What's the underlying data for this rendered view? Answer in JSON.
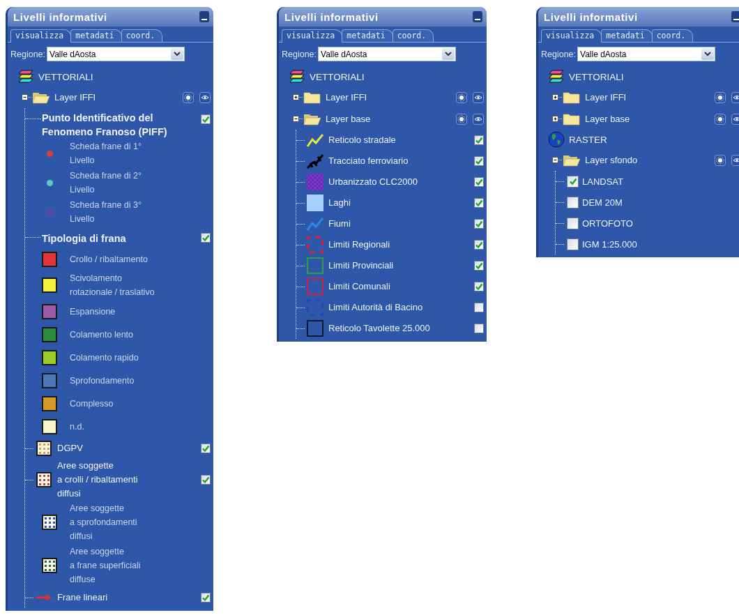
{
  "panels": [
    {
      "title": "Livelli informativi",
      "tabs": [
        {
          "label": "visualizza",
          "selected": true
        },
        {
          "label": "metadati",
          "selected": false
        },
        {
          "label": "coord.",
          "selected": false
        }
      ],
      "region": {
        "label": "Regione:",
        "value": "Valle dAosta"
      },
      "tree": [
        {
          "kind": "category",
          "symbol": {
            "kind": "layers"
          },
          "label": "VETTORIALI",
          "children": [
            {
              "kind": "folder",
              "label": "Layer IFFI",
              "expanded": true,
              "children": [
                {
                  "kind": "section",
                  "label": "Punto Identificativo del\nFenomeno Franoso (PIFF)",
                  "checked": true,
                  "legend": [
                    {
                      "symbol": {
                        "kind": "dot",
                        "color": "#e03c3c"
                      },
                      "label": "Scheda frane di 1°\nLivello"
                    },
                    {
                      "symbol": {
                        "kind": "dot",
                        "color": "#5ec8c8"
                      },
                      "label": "Scheda frane di 2°\nLivello"
                    },
                    {
                      "symbol": {
                        "kind": "dot",
                        "color": "#6a3f9a"
                      },
                      "label": "Scheda frane di 3°\nLivello"
                    }
                  ]
                },
                {
                  "kind": "section",
                  "label": "Tipologia di frana",
                  "checked": true,
                  "legend": [
                    {
                      "symbol": {
                        "kind": "square",
                        "color": "#e0363a"
                      },
                      "label": "Crollo / ribaltamento"
                    },
                    {
                      "symbol": {
                        "kind": "square",
                        "color": "#f4f03c"
                      },
                      "label": "Scivolamento\nrotazionale / traslativo"
                    },
                    {
                      "symbol": {
                        "kind": "square",
                        "color": "#9a5aa6"
                      },
                      "label": "Espansione"
                    },
                    {
                      "symbol": {
                        "kind": "square",
                        "color": "#2a8a3c"
                      },
                      "label": "Colamento lento"
                    },
                    {
                      "symbol": {
                        "kind": "square",
                        "color": "#9ccc2c"
                      },
                      "label": "Colamento rapido"
                    },
                    {
                      "symbol": {
                        "kind": "square",
                        "color": "#4a78b8"
                      },
                      "label": "Sprofondamento"
                    },
                    {
                      "symbol": {
                        "kind": "square",
                        "color": "#d49a2a"
                      },
                      "label": "Complesso"
                    },
                    {
                      "symbol": {
                        "kind": "square",
                        "color": "#fbf6c8"
                      },
                      "label": "n.d."
                    }
                  ]
                },
                {
                  "kind": "layer",
                  "label": "DGPV",
                  "checked": true,
                  "symbol": {
                    "kind": "dots",
                    "color": "#d4a040"
                  }
                },
                {
                  "kind": "layer",
                  "label": "Aree soggette\na crolli / ribaltamenti\ndiffusi",
                  "checked": true,
                  "symbol": {
                    "kind": "dots",
                    "color": "#d04040"
                  },
                  "legend": [
                    {
                      "symbol": {
                        "kind": "dots",
                        "color": "#3050a0"
                      },
                      "label": "Aree soggette\na sprofondamenti\ndiffusi"
                    },
                    {
                      "symbol": {
                        "kind": "dots",
                        "color": "#2a6a3a"
                      },
                      "label": "Aree soggette\na frane superficiali\ndiffuse"
                    }
                  ]
                },
                {
                  "kind": "layer",
                  "label": "Frane lineari",
                  "checked": true,
                  "symbol": {
                    "kind": "arrow",
                    "color": "#e03030"
                  }
                }
              ]
            }
          ]
        }
      ]
    },
    {
      "title": "Livelli informativi",
      "tabs": [
        {
          "label": "visualizza",
          "selected": true
        },
        {
          "label": "metadati",
          "selected": false
        },
        {
          "label": "coord.",
          "selected": false
        }
      ],
      "region": {
        "label": "Regione:",
        "value": "Valle dAosta"
      },
      "tree": [
        {
          "kind": "category",
          "symbol": {
            "kind": "layers"
          },
          "label": "VETTORIALI",
          "children": [
            {
              "kind": "folder",
              "label": "Layer IFFI",
              "expanded": false
            },
            {
              "kind": "folder",
              "label": "Layer base",
              "expanded": true,
              "children": [
                {
                  "kind": "layer",
                  "label": "Reticolo stradale",
                  "checked": true,
                  "symbol": {
                    "kind": "zigzag",
                    "color": "#e8e83a"
                  }
                },
                {
                  "kind": "layer",
                  "label": "Tracciato ferroviario",
                  "checked": true,
                  "symbol": {
                    "kind": "rail"
                  }
                },
                {
                  "kind": "layer",
                  "label": "Urbanizzato CLC2000",
                  "checked": true,
                  "symbol": {
                    "kind": "hatch",
                    "color": "#7a3ad0"
                  }
                },
                {
                  "kind": "layer",
                  "label": "Laghi",
                  "checked": true,
                  "symbol": {
                    "kind": "fill",
                    "color": "#a8d0ff"
                  }
                },
                {
                  "kind": "layer",
                  "label": "Fiumi",
                  "checked": true,
                  "symbol": {
                    "kind": "zigzag",
                    "color": "#2a8ae8"
                  }
                },
                {
                  "kind": "layer",
                  "label": "Limiti Regionali",
                  "checked": true,
                  "symbol": {
                    "kind": "dashed-outline",
                    "color": "#e02030"
                  }
                },
                {
                  "kind": "layer",
                  "label": "Limiti Provinciali",
                  "checked": true,
                  "symbol": {
                    "kind": "outline",
                    "color": "#2aa040"
                  }
                },
                {
                  "kind": "layer",
                  "label": "Limiti Comunali",
                  "checked": true,
                  "symbol": {
                    "kind": "outline",
                    "color": "#d02040"
                  }
                },
                {
                  "kind": "layer",
                  "label": "Limiti Autorità di Bacino",
                  "checked": false,
                  "symbol": {
                    "kind": "dashed-outline",
                    "color": "#1e48b0"
                  }
                },
                {
                  "kind": "layer",
                  "label": "Reticolo Tavolette 25.000",
                  "checked": false,
                  "symbol": {
                    "kind": "outline",
                    "color": "#101830"
                  }
                }
              ]
            }
          ]
        }
      ]
    },
    {
      "title": "Livelli informativi",
      "tabs": [
        {
          "label": "visualizza",
          "selected": true
        },
        {
          "label": "metadati",
          "selected": false
        },
        {
          "label": "coord.",
          "selected": false
        }
      ],
      "region": {
        "label": "Regione:",
        "value": "Valle dAosta"
      },
      "tree": [
        {
          "kind": "category",
          "symbol": {
            "kind": "layers"
          },
          "label": "VETTORIALI",
          "children": [
            {
              "kind": "folder",
              "label": "Layer IFFI",
              "expanded": false
            },
            {
              "kind": "folder",
              "label": "Layer base",
              "expanded": false
            }
          ]
        },
        {
          "kind": "category",
          "symbol": {
            "kind": "globe"
          },
          "label": "RASTER",
          "children": [
            {
              "kind": "folder",
              "label": "Layer sfondo",
              "expanded": true,
              "children": [
                {
                  "kind": "check",
                  "label": "LANDSAT",
                  "checked": true
                },
                {
                  "kind": "check",
                  "label": "DEM 20M",
                  "checked": false
                },
                {
                  "kind": "check",
                  "label": "ORTOFOTO",
                  "checked": false
                },
                {
                  "kind": "check",
                  "label": "IGM 1:25.000",
                  "checked": false
                }
              ]
            }
          ]
        }
      ]
    }
  ]
}
